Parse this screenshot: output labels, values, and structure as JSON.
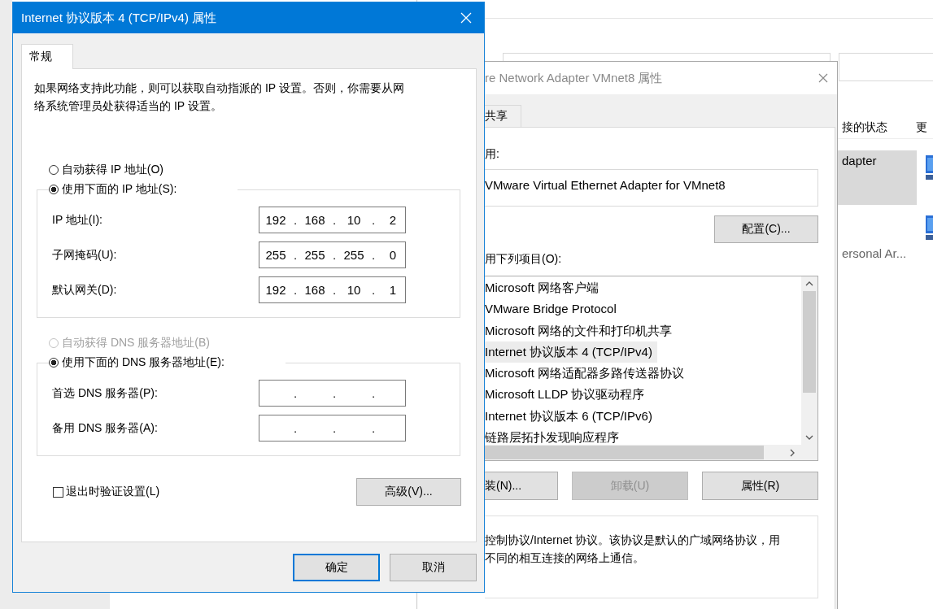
{
  "explorer": {
    "toolbar": [
      {
        "label": "接的状态"
      },
      {
        "label": "更"
      }
    ],
    "items": [
      {
        "label": "dapter",
        "selected": true
      },
      {
        "label": "ersonal Ar...",
        "selected": false
      }
    ]
  },
  "adapter_dialog": {
    "title": "re Network Adapter VMnet8 属性",
    "tabs": [
      {
        "label": "共享",
        "selected": false
      }
    ],
    "connect_using_label": "用:",
    "adapter": "VMware Virtual Ethernet Adapter for VMnet8",
    "configure_button": "配置(C)...",
    "items_label": "用下列项目(O):",
    "items": [
      {
        "label": "Microsoft 网络客户端",
        "selected": false
      },
      {
        "label": "VMware Bridge Protocol",
        "selected": false
      },
      {
        "label": "Microsoft 网络的文件和打印机共享",
        "selected": false
      },
      {
        "label": "Internet 协议版本 4 (TCP/IPv4)",
        "selected": true
      },
      {
        "label": "Microsoft 网络适配器多路传送器协议",
        "selected": false
      },
      {
        "label": "Microsoft LLDP 协议驱动程序",
        "selected": false
      },
      {
        "label": "Internet 协议版本 6 (TCP/IPv6)",
        "selected": false
      },
      {
        "label": "链路层拓扑发现响应程序",
        "selected": false
      }
    ],
    "buttons": [
      {
        "label": "装(N)...",
        "disabled": false
      },
      {
        "label": "卸载(U)",
        "disabled": true
      },
      {
        "label": "属性(R)",
        "disabled": false
      }
    ],
    "description_lines": [
      "控制协议/Internet 协议。该协议是默认的广域网络协议，用",
      "不同的相互连接的网络上通信。"
    ]
  },
  "ipv4_dialog": {
    "title": "Internet 协议版本 4 (TCP/IPv4) 属性",
    "tabs": [
      {
        "label": "常规",
        "selected": true
      }
    ],
    "description_lines": [
      "如果网络支持此功能，则可以获取自动指派的 IP 设置。否则，你需要从网",
      "络系统管理员处获得适当的 IP 设置。"
    ],
    "ip_separator": ".",
    "ip_mode": [
      {
        "label": "自动获得 IP 地址(O)",
        "selected": false,
        "disabled": false
      },
      {
        "label": "使用下面的 IP 地址(S):",
        "selected": true,
        "disabled": false
      }
    ],
    "ip_fields": [
      {
        "label": "IP 地址(I):",
        "octets": [
          "192",
          "168",
          "10",
          "2"
        ]
      },
      {
        "label": "子网掩码(U):",
        "octets": [
          "255",
          "255",
          "255",
          "0"
        ]
      },
      {
        "label": "默认网关(D):",
        "octets": [
          "192",
          "168",
          "10",
          "1"
        ]
      }
    ],
    "dns_mode": [
      {
        "label": "自动获得 DNS 服务器地址(B)",
        "selected": false,
        "disabled": true
      },
      {
        "label": "使用下面的 DNS 服务器地址(E):",
        "selected": true,
        "disabled": false
      }
    ],
    "dns_fields": [
      {
        "label": "首选 DNS 服务器(P):"
      },
      {
        "label": "备用 DNS 服务器(A):"
      }
    ],
    "validate_on_exit": {
      "label": "退出时验证设置(L)",
      "checked": false
    },
    "advanced_button": "高级(V)...",
    "buttons": [
      {
        "label": "确定",
        "default": true
      },
      {
        "label": "取消",
        "default": false
      }
    ]
  }
}
